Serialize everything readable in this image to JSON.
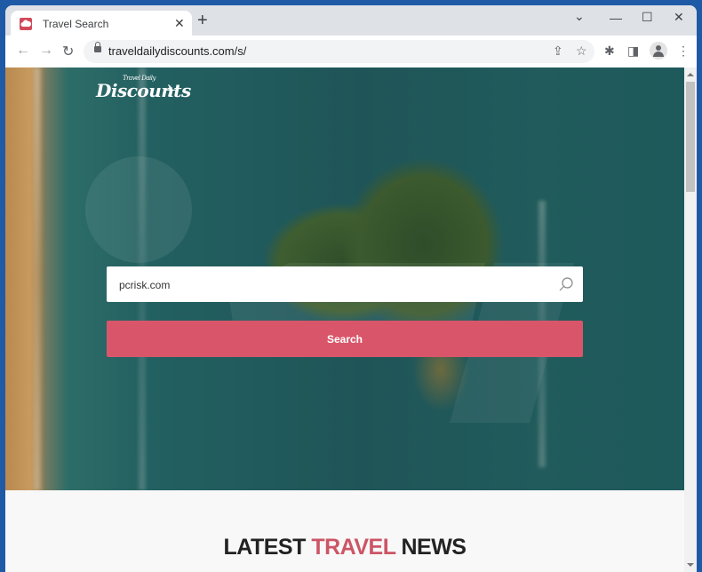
{
  "browser": {
    "tab": {
      "title": "Travel Search",
      "favicon": "cloud-icon"
    },
    "new_tab_label": "+",
    "url": "traveldailydiscounts.com/s/",
    "window_controls": [
      "chevron-down-icon",
      "minimize-icon",
      "maximize-icon",
      "close-icon"
    ]
  },
  "page": {
    "logo": {
      "main": "Discounts",
      "small": "Travel Daily"
    },
    "search": {
      "value": "pcrisk.com",
      "placeholder": "",
      "button_label": "Search"
    },
    "news_heading": {
      "part1": "LATEST ",
      "accent": "TRAVEL",
      "part2": " NEWS"
    },
    "colors": {
      "accent": "#d9566a",
      "heading_accent": "#cc5566"
    }
  }
}
